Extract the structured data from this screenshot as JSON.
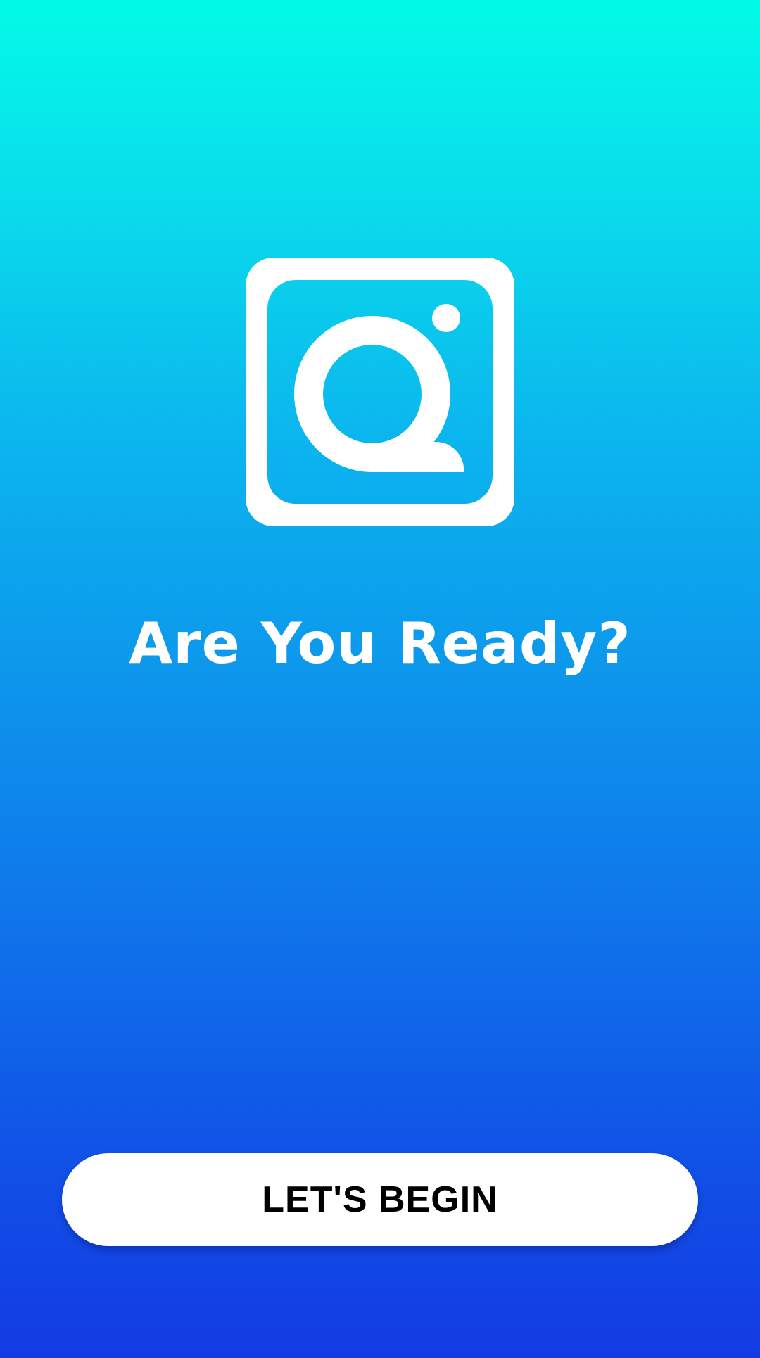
{
  "app": {
    "logo_icon": "camera-q-logo-icon",
    "headline": "Are You Ready?",
    "cta_label": "LET'S BEGIN"
  },
  "colors": {
    "gradient_top": "#02fbe8",
    "gradient_bottom": "#133be4",
    "foreground": "#ffffff",
    "button_text": "#000000"
  }
}
